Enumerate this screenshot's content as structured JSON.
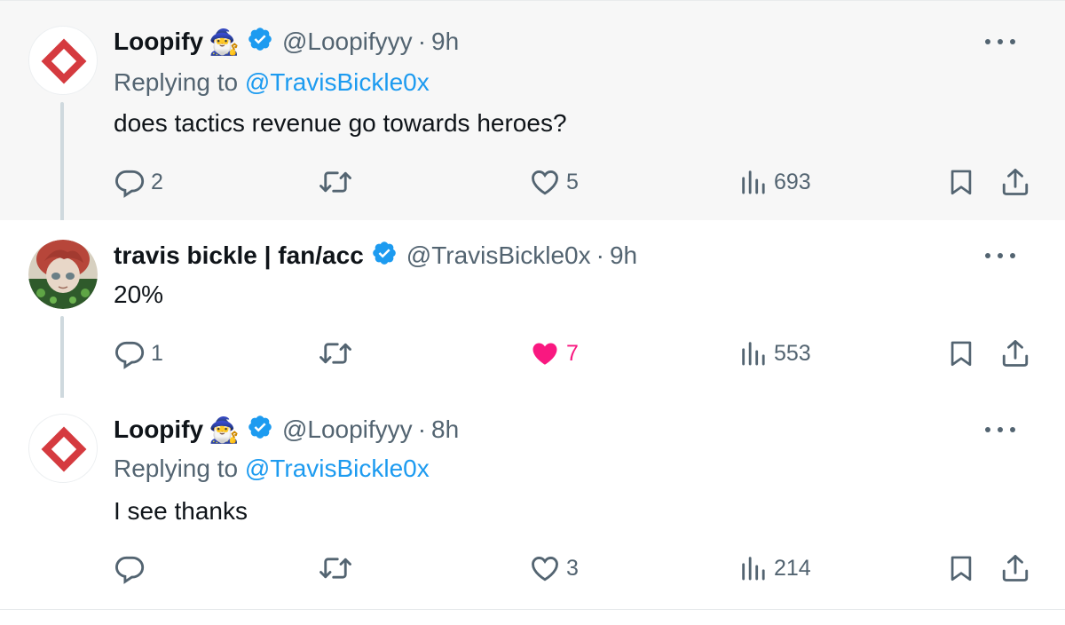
{
  "colors": {
    "link": "#1d9bf0",
    "muted": "#536471",
    "like_active": "#f91880",
    "verified": "#1d9bf0"
  },
  "tweets": [
    {
      "display_name": "Loopify",
      "emoji": "🧙‍♂️",
      "handle": "@Loopifyyy",
      "separator": "·",
      "time": "9h",
      "replying_prefix": "Replying to",
      "replying_to": "@TravisBickle0x",
      "text": "does tactics revenue go towards heroes?",
      "reply_count": "2",
      "retweet_count": "",
      "like_count": "5",
      "view_count": "693",
      "liked": false
    },
    {
      "display_name": "travis bickle | fan/acc",
      "handle": "@TravisBickle0x",
      "separator": "·",
      "time": "9h",
      "text": "20%",
      "reply_count": "1",
      "retweet_count": "",
      "like_count": "7",
      "view_count": "553",
      "liked": true
    },
    {
      "display_name": "Loopify",
      "emoji": "🧙‍♂️",
      "handle": "@Loopifyyy",
      "separator": "·",
      "time": "8h",
      "replying_prefix": "Replying to",
      "replying_to": "@TravisBickle0x",
      "text": "I see thanks",
      "reply_count": "",
      "retweet_count": "",
      "like_count": "3",
      "view_count": "214",
      "liked": false
    }
  ],
  "icons": {
    "avatar_loopify": "red-diamond-logo",
    "avatar_travis": "anime-character-avatar",
    "verified": "verified-badge-icon",
    "more": "more-options-icon",
    "reply": "reply-icon",
    "retweet": "retweet-icon",
    "like": "heart-icon",
    "views": "views-icon",
    "bookmark": "bookmark-icon",
    "share": "share-icon"
  }
}
